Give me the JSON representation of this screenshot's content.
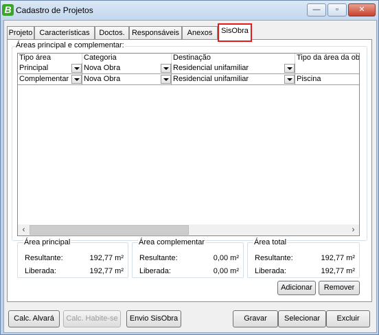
{
  "window": {
    "title": "Cadastro de Projetos",
    "app_icon_letter": "B",
    "controls": {
      "minimize": "—",
      "maximize": "▫",
      "close": "✕"
    }
  },
  "tabs": [
    {
      "label": "Projeto"
    },
    {
      "label": "Características"
    },
    {
      "label": "Doctos."
    },
    {
      "label": "Responsáveis"
    },
    {
      "label": "Anexos"
    },
    {
      "label": "SisObra",
      "active": true
    }
  ],
  "areas_group": {
    "title": "Áreas principal e complementar:",
    "columns": [
      "Tipo área",
      "Categoria",
      "Destinação",
      "Tipo da área da ob"
    ],
    "rows": [
      {
        "tipo": "Principal",
        "categoria": "Nova Obra",
        "destinacao": "Residencial unifamiliar",
        "tipo_area": ""
      },
      {
        "tipo": "Complementar",
        "categoria": "Nova Obra",
        "destinacao": "Residencial unifamiliar",
        "tipo_area": "Piscina"
      }
    ]
  },
  "summary": {
    "principal": {
      "title": "Área principal",
      "resultante_label": "Resultante:",
      "resultante": "192,77 m²",
      "liberada_label": "Liberada:",
      "liberada": "192,77 m²"
    },
    "complementar": {
      "title": "Área complementar",
      "resultante_label": "Resultante:",
      "resultante": "0,00 m²",
      "liberada_label": "Liberada:",
      "liberada": "0,00 m²"
    },
    "total": {
      "title": "Área total",
      "resultante_label": "Resultante:",
      "resultante": "192,77 m²",
      "liberada_label": "Liberada:",
      "liberada": "192,77 m²"
    }
  },
  "grid_buttons": {
    "add": "Adicionar",
    "remove": "Remover"
  },
  "footer": {
    "calc_alvara": "Calc. Alvará",
    "calc_habite": "Calc. Habite-se",
    "envio_sisobra": "Envio SisObra",
    "gravar": "Gravar",
    "selecionar": "Selecionar",
    "excluir": "Excluir"
  },
  "colors": {
    "highlight": "#e31b1b",
    "frame": "#bcd2ea"
  }
}
